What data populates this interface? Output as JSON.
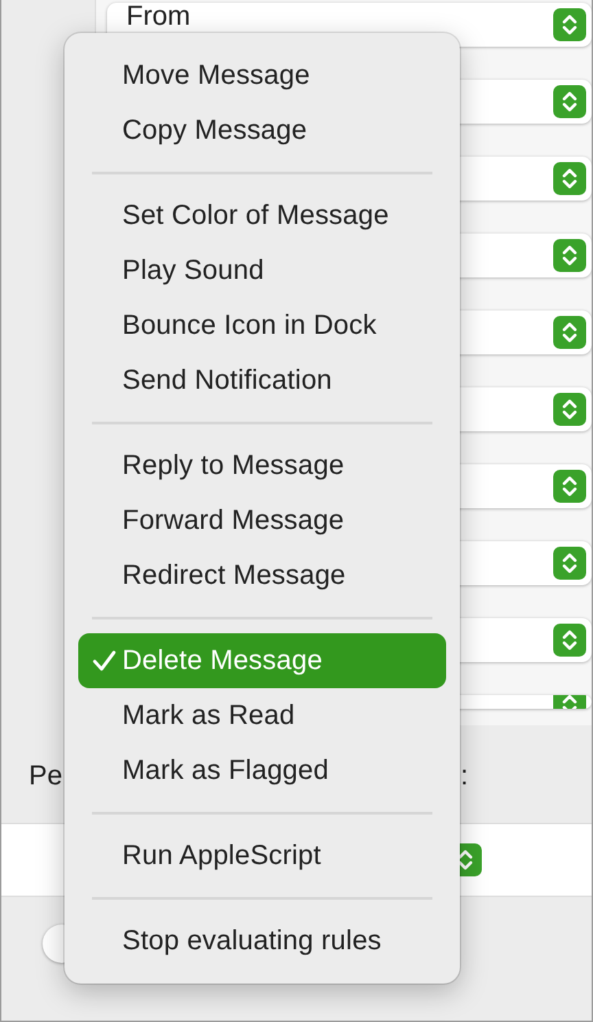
{
  "rule_rows": [
    {
      "kind": "popup",
      "value": "From"
    },
    {
      "kind": "popup"
    },
    {
      "kind": "popup"
    },
    {
      "kind": "popup"
    },
    {
      "kind": "popup"
    },
    {
      "kind": "popup"
    },
    {
      "kind": "popup"
    },
    {
      "kind": "popup"
    },
    {
      "kind": "popup"
    },
    {
      "kind": "popup-cut"
    }
  ],
  "actions_label": {
    "start": "Pe",
    "end": ":"
  },
  "action_row": {
    "kind": "popup"
  },
  "help_button": {
    "kind": "help"
  },
  "menu": {
    "sections": [
      [
        {
          "label": "Move Message",
          "checked": false,
          "selected": false
        },
        {
          "label": "Copy Message",
          "checked": false,
          "selected": false
        }
      ],
      [
        {
          "label": "Set Color of Message",
          "checked": false,
          "selected": false
        },
        {
          "label": "Play Sound",
          "checked": false,
          "selected": false
        },
        {
          "label": "Bounce Icon in Dock",
          "checked": false,
          "selected": false
        },
        {
          "label": "Send Notification",
          "checked": false,
          "selected": false
        }
      ],
      [
        {
          "label": "Reply to Message",
          "checked": false,
          "selected": false
        },
        {
          "label": "Forward Message",
          "checked": false,
          "selected": false
        },
        {
          "label": "Redirect Message",
          "checked": false,
          "selected": false
        }
      ],
      [
        {
          "label": "Delete Message",
          "checked": true,
          "selected": true
        },
        {
          "label": "Mark as Read",
          "checked": false,
          "selected": false
        },
        {
          "label": "Mark as Flagged",
          "checked": false,
          "selected": false
        }
      ],
      [
        {
          "label": "Run AppleScript",
          "checked": false,
          "selected": false
        }
      ],
      [
        {
          "label": "Stop evaluating rules",
          "checked": false,
          "selected": false
        }
      ]
    ]
  }
}
